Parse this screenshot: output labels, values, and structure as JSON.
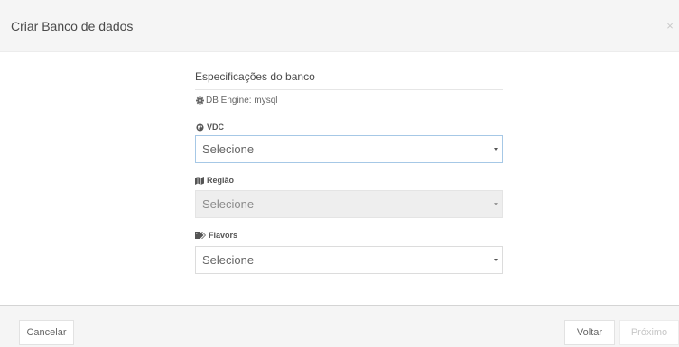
{
  "modal": {
    "title": "Criar Banco de dados",
    "close_label": "×"
  },
  "form": {
    "section_title": "Especificações do banco",
    "engine_text": "DB Engine: mysql",
    "fields": [
      {
        "label": "VDC",
        "icon": "globe-icon",
        "value": "Selecione",
        "state": "focused"
      },
      {
        "label": "Região",
        "icon": "map-icon",
        "value": "Selecione",
        "state": "disabled"
      },
      {
        "label": "Flavors",
        "icon": "tags-icon",
        "value": "Selecione",
        "state": "normal"
      }
    ]
  },
  "footer": {
    "cancel_label": "Cancelar",
    "back_label": "Voltar",
    "next_label": "Próximo"
  },
  "colors": {
    "header_bg": "#f5f5f5",
    "focus_border": "#a6c8e6",
    "disabled_bg": "#eeeeee"
  }
}
